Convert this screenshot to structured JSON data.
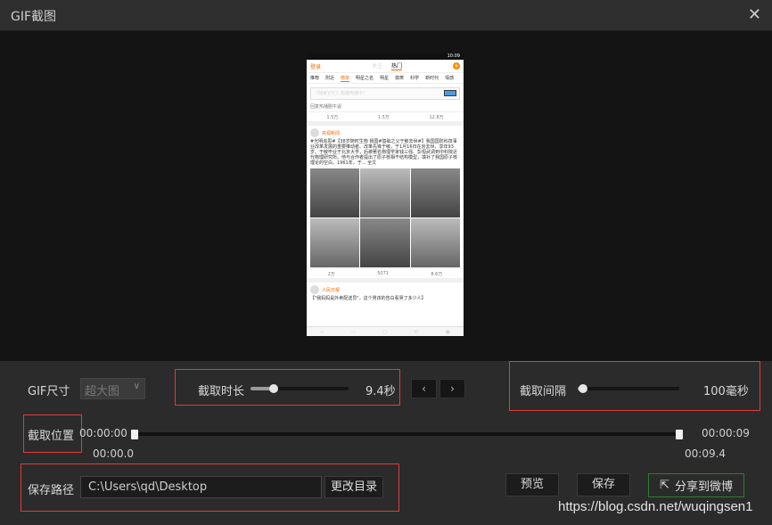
{
  "window": {
    "title": "GIF截图",
    "close": "✕"
  },
  "phone": {
    "time": "10:09",
    "top_left": "登录",
    "top_tabs": [
      "关注",
      "热门"
    ],
    "tabs": [
      "推荐",
      "附近",
      "榜单",
      "明星之名",
      "明星",
      "搞笑",
      "科学",
      "新时代",
      "情感"
    ],
    "banner": "《独家记忆》题播热播中！",
    "sub_line": "回复热播剧牛逼",
    "actions1": [
      "1.5万",
      "1.5万",
      "12.8万"
    ],
    "user1": "央视新闻",
    "post_text": "#光明追思#【38岁随时生物 我国#基础之父于敏去世#】我国国防科技事业改革发展的重要推动者、改革先锋于敏，于1月16日在京去世，享年93岁。于敏毕业于北京大学，后被著名物理学家钱三强、彭桓武调到中科院近代物理研究所。他与合作者提出了原子核相干结构模型，填补了我国原子核理论的空白。1961年，于... 全文",
    "actions2": [
      "2万",
      "5071",
      "8.6万"
    ],
    "user2": "人民日报",
    "post2": "【\"我妈妈是外卖配送员\"，这个男孩的告白看哭了多少人】"
  },
  "controls": {
    "gif_size_label": "GIF尺寸",
    "gif_size_value": "超大图",
    "duration_label": "截取时长",
    "duration_value": "9.4秒",
    "duration_fraction": 0.24,
    "prev": "‹",
    "next": "›",
    "interval_label": "截取间隔",
    "interval_value": "100毫秒",
    "interval_fraction": 0.05,
    "position_label": "截取位置",
    "start_time": "00:00:00",
    "end_time": "00:00:09",
    "start_sel": "00:00.0",
    "end_sel": "00:09.4",
    "save_path_label": "保存路径",
    "save_path": "C:\\Users\\qd\\Desktop",
    "change_dir": "更改目录",
    "preview": "预览",
    "save": "保存",
    "share": "分享到微博"
  },
  "watermark": "https://blog.csdn.net/wuqingsen1",
  "colors": {
    "highlight": "#e03c3c",
    "share_border": "#2e7d32",
    "bg": "#2b2b2b"
  }
}
